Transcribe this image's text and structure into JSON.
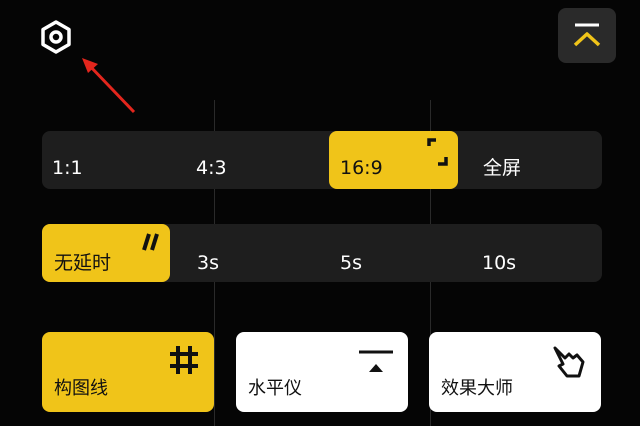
{
  "top": {
    "settings_icon": "hexagon-settings-icon",
    "collapse_icon": "chevron-up-bar-icon",
    "accent": "#f0c419"
  },
  "aspect_ratio": {
    "options": [
      "1:1",
      "4:3",
      "16:9",
      "全屏"
    ],
    "selected": "16:9",
    "selected_icon": "fullscreen-corners-icon"
  },
  "timer": {
    "options": [
      "无延时",
      "3s",
      "5s",
      "10s"
    ],
    "selected": "无延时",
    "selected_icon": "double-slash-icon"
  },
  "tools": [
    {
      "label": "构图线",
      "icon": "grid-hash-icon",
      "active": true
    },
    {
      "label": "水平仪",
      "icon": "level-icon",
      "active": false
    },
    {
      "label": "效果大师",
      "icon": "hand-pointer-icon",
      "active": false
    }
  ]
}
